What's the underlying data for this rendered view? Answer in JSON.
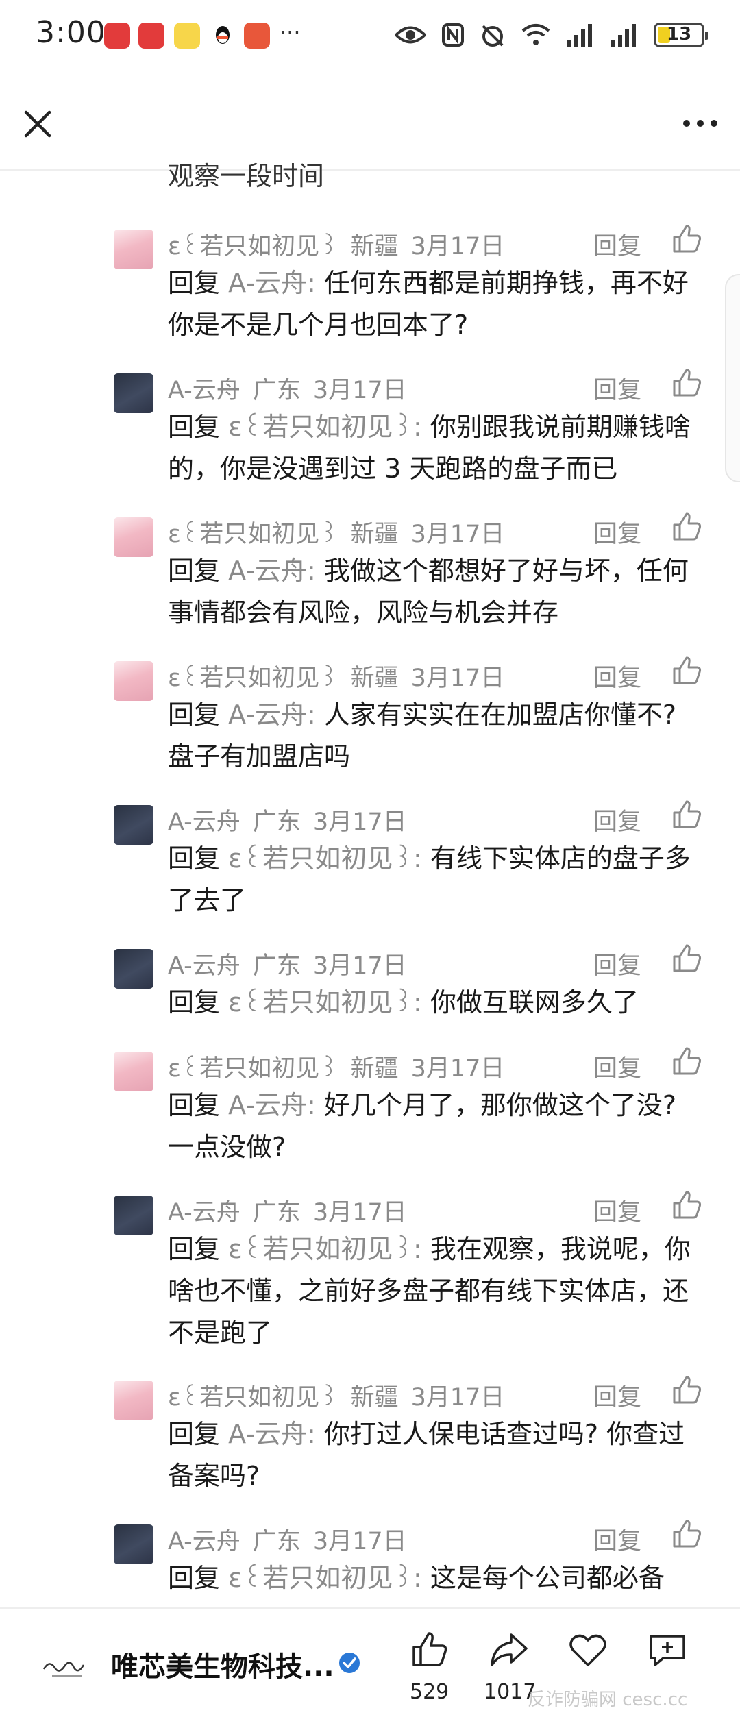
{
  "status_bar": {
    "time": "3:00",
    "dots": "···",
    "battery": "13"
  },
  "truncated_text": "观察一段时间",
  "comments": [
    {
      "user": "ɛ꒰若只如初见꒱",
      "region": "新疆",
      "date": "3月17日",
      "reply_label": "回复",
      "reply_prefix": "回复",
      "reply_target": "A-云舟:",
      "text": "任何东西都是前期挣钱，再不好你是不是几个月也回本了?",
      "avatar": "pink"
    },
    {
      "user": "A-云舟",
      "region": "广东",
      "date": "3月17日",
      "reply_label": "回复",
      "reply_prefix": "回复",
      "reply_target": "ɛ꒰若只如初见꒱:",
      "text": "你别跟我说前期赚钱啥的，你是没遇到过 3 天跑路的盘子而已",
      "avatar": "dark"
    },
    {
      "user": "ɛ꒰若只如初见꒱",
      "region": "新疆",
      "date": "3月17日",
      "reply_label": "回复",
      "reply_prefix": "回复",
      "reply_target": "A-云舟:",
      "text": "我做这个都想好了好与坏，任何事情都会有风险，风险与机会并存",
      "avatar": "pink"
    },
    {
      "user": "ɛ꒰若只如初见꒱",
      "region": "新疆",
      "date": "3月17日",
      "reply_label": "回复",
      "reply_prefix": "回复",
      "reply_target": "A-云舟:",
      "text": "人家有实实在在加盟店你懂不? 盘子有加盟店吗",
      "avatar": "pink"
    },
    {
      "user": "A-云舟",
      "region": "广东",
      "date": "3月17日",
      "reply_label": "回复",
      "reply_prefix": "回复",
      "reply_target": "ɛ꒰若只如初见꒱:",
      "text": "有线下实体店的盘子多了去了",
      "avatar": "dark"
    },
    {
      "user": "A-云舟",
      "region": "广东",
      "date": "3月17日",
      "reply_label": "回复",
      "reply_prefix": "回复",
      "reply_target": "ɛ꒰若只如初见꒱:",
      "text": "你做互联网多久了",
      "avatar": "dark"
    },
    {
      "user": "ɛ꒰若只如初见꒱",
      "region": "新疆",
      "date": "3月17日",
      "reply_label": "回复",
      "reply_prefix": "回复",
      "reply_target": "A-云舟:",
      "text": "好几个月了，那你做这个了没? 一点没做?",
      "avatar": "pink"
    },
    {
      "user": "A-云舟",
      "region": "广东",
      "date": "3月17日",
      "reply_label": "回复",
      "reply_prefix": "回复",
      "reply_target": "ɛ꒰若只如初见꒱:",
      "text": "我在观察，我说呢，你啥也不懂，之前好多盘子都有线下实体店，还不是跑了",
      "avatar": "dark"
    },
    {
      "user": "ɛ꒰若只如初见꒱",
      "region": "新疆",
      "date": "3月17日",
      "reply_label": "回复",
      "reply_prefix": "回复",
      "reply_target": "A-云舟:",
      "text": "你打过人保电话查过吗? 你查过备案吗?",
      "avatar": "pink"
    },
    {
      "user": "A-云舟",
      "region": "广东",
      "date": "3月17日",
      "reply_label": "回复",
      "reply_prefix": "回复",
      "reply_target": "ɛ꒰若只如初见꒱:",
      "text": "这是每个公司都必备",
      "avatar": "dark"
    }
  ],
  "bottom_bar": {
    "brand_name": "唯芯美生物科技...",
    "like_count": "529",
    "share_count": "1017",
    "watermark": "反诈防骗网 cesc.cc"
  }
}
